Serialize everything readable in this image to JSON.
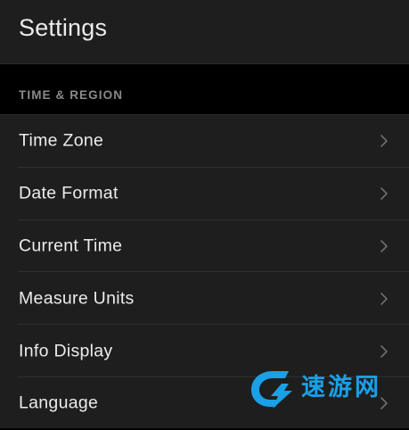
{
  "header": {
    "title": "Settings"
  },
  "section": {
    "label": "TIME & REGION"
  },
  "items": [
    {
      "label": "Time Zone",
      "icon": "chevron-right-icon"
    },
    {
      "label": "Date Format",
      "icon": "chevron-right-icon"
    },
    {
      "label": "Current Time",
      "icon": "chevron-right-icon"
    },
    {
      "label": "Measure Units",
      "icon": "chevron-right-icon"
    },
    {
      "label": "Info Display",
      "icon": "chevron-right-icon"
    },
    {
      "label": "Language",
      "icon": "chevron-right-icon"
    }
  ],
  "watermark": {
    "text": "速游网",
    "icon": "lightning-logo-icon",
    "accent": "#1aa0e6"
  },
  "colors": {
    "background": "#1e1e1f",
    "section_band": "#000000",
    "text": "#ececec",
    "section_label": "#8a8a8d",
    "chevron": "#6e6e72",
    "divider": "#303033"
  }
}
